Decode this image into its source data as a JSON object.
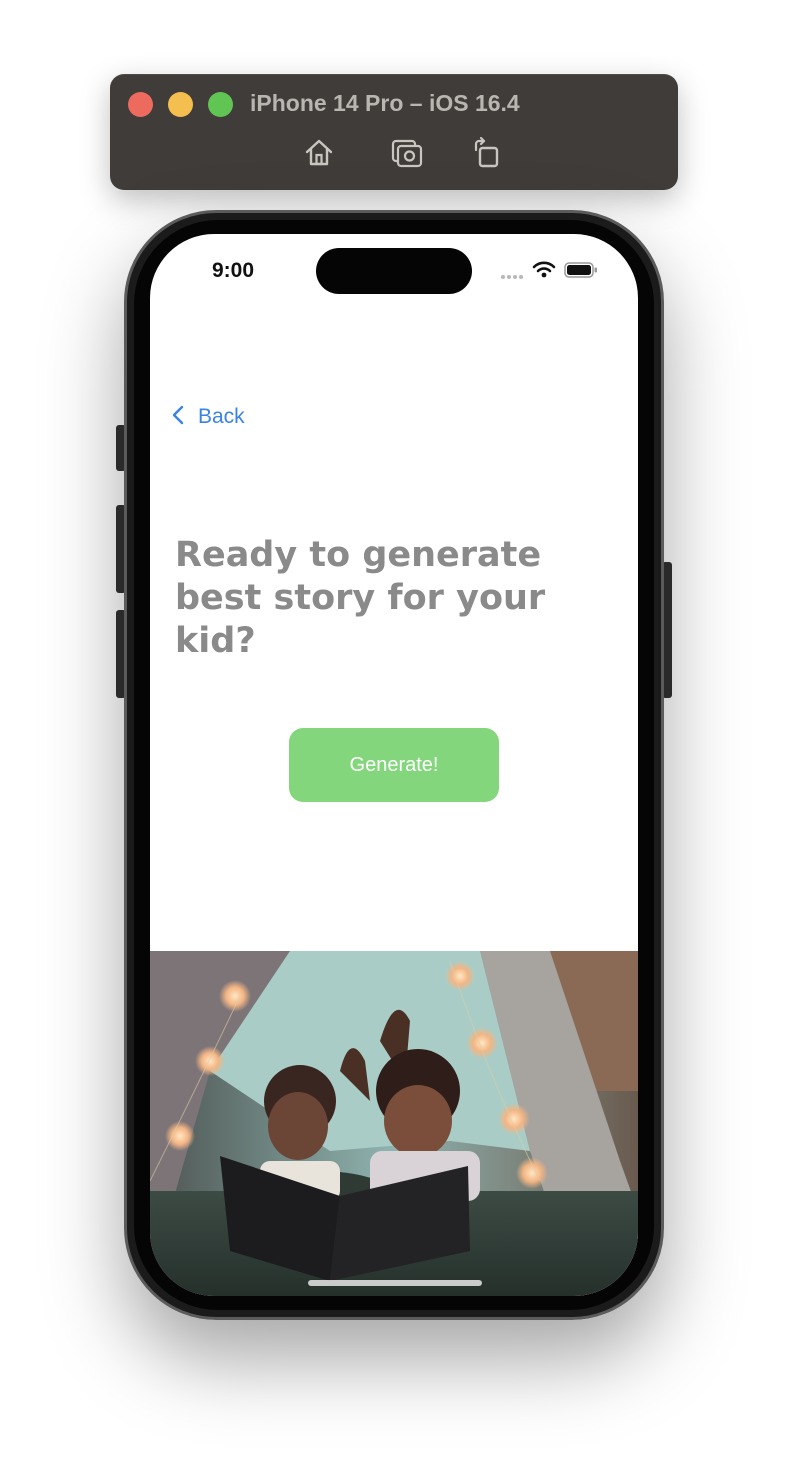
{
  "simulator": {
    "title": "iPhone 14 Pro – iOS 16.4",
    "buttons": [
      "home-icon",
      "screenshot-icon",
      "rotate-icon"
    ]
  },
  "status_bar": {
    "time": "9:00",
    "icons": [
      "signal-icon",
      "wifi-icon",
      "battery-icon"
    ]
  },
  "nav": {
    "back_label": "Back"
  },
  "main": {
    "headline": "Ready to generate best story for your kid?",
    "generate_label": "Generate!"
  },
  "colors": {
    "accent_blue": "#3a83e6",
    "button_green": "#83d67c",
    "headline_gray": "#8a8a8a"
  },
  "image": {
    "subject": "illustration-kids-reading-in-tent"
  }
}
